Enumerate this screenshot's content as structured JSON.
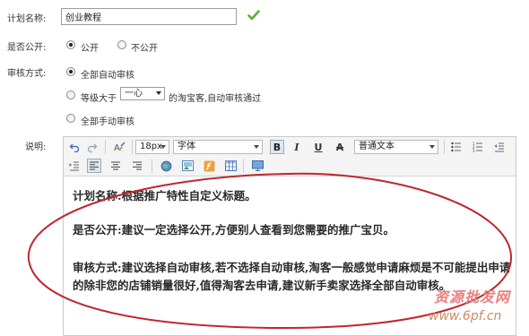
{
  "form": {
    "plan_name_label": "计划名称:",
    "plan_name_value": "创业教程",
    "public_label": "是否公开:",
    "public_options": [
      "公开",
      "不公开"
    ],
    "public_selected": "公开",
    "review_label": "审核方式:",
    "review_option_all_auto": "全部自动审核",
    "review_option_level_prefix": "等级大于",
    "review_level_value": "一心",
    "review_option_level_suffix": "的淘宝客,自动审核通过",
    "review_option_all_manual": "全部手动审核",
    "review_selected": "全部自动审核",
    "desc_label": "说明:"
  },
  "editor": {
    "font_size": "18px",
    "font_family": "字体",
    "paragraph_format": "普通文本",
    "content": [
      "计划名称:根据推广特性自定义标题。",
      "是否公开:建议一定选择公开,方便别人查看到您需要的推广宝贝。",
      "审核方式:建议选择自动审核,若不选择自动审核,淘客一般感觉申请麻烦是不可能提出申请的除非您的店铺销量很好,值得淘客去申请,建议新手卖家选择全部自动审核。"
    ]
  },
  "watermark": {
    "text": "资源批发网",
    "url": "www.6pf.cn"
  },
  "colors": {
    "ellipse": "#c0262c",
    "check": "#5cae2f",
    "bold_active_bg": "#dfe6ef"
  },
  "icons": [
    "check-icon",
    "undo-icon",
    "redo-icon",
    "format-painter-icon",
    "bold-icon",
    "italic-icon",
    "underline-icon",
    "strikethrough-icon",
    "unordered-list-icon",
    "ordered-list-icon",
    "outdent-icon",
    "indent-icon",
    "align-left-icon",
    "align-center-icon",
    "align-right-icon",
    "link-icon",
    "image-icon",
    "flash-icon",
    "table-icon",
    "media-icon"
  ]
}
